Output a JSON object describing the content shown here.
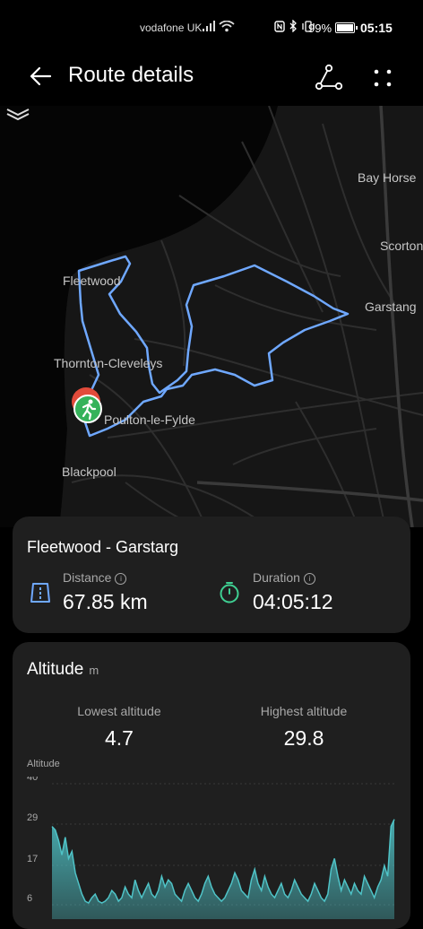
{
  "status": {
    "carrier": "vodafone UK",
    "battery": "99%",
    "time": "05:15"
  },
  "header": {
    "title": "Route details"
  },
  "map": {
    "labels": {
      "bay_horse": "Bay Horse",
      "scorton": "Scorton",
      "fleetwood": "Fleetwood",
      "garstang": "Garstang",
      "thornton": "Thornton-Cleveleys",
      "poulton": "Poulton-le-Fylde",
      "blackpool": "Blackpool"
    },
    "route_color": "#6fa8ff",
    "start_marker_color": "#35b25a"
  },
  "route": {
    "name": "Fleetwood - Garstarg",
    "distance_label": "Distance",
    "distance_value": "67.85 km",
    "duration_label": "Duration",
    "duration_value": "04:05:12"
  },
  "altitude": {
    "title": "Altitude",
    "unit": "m",
    "lowest_label": "Lowest altitude",
    "lowest_value": "4.7",
    "highest_label": "Highest altitude",
    "highest_value": "29.8"
  },
  "chart_data": {
    "type": "area",
    "title": "",
    "xlabel": "",
    "ylabel": "Altitude",
    "y_ticks": [
      "40",
      "29",
      "17",
      "6"
    ],
    "ylim": [
      6,
      40
    ],
    "color": "#4fc3c7",
    "values": [
      28,
      27,
      24,
      20,
      25,
      19,
      21,
      15,
      12,
      9,
      7,
      6.5,
      8,
      9,
      7,
      6.5,
      7,
      8,
      10,
      9,
      7,
      8,
      11,
      9,
      8,
      13,
      10,
      8,
      10,
      12,
      9,
      8,
      10,
      14,
      11,
      13,
      12,
      9,
      8,
      7,
      10,
      12,
      10,
      8,
      7,
      9,
      12,
      14,
      11,
      9,
      8,
      7,
      8,
      10,
      12,
      15,
      13,
      10,
      9,
      8,
      13,
      16,
      12,
      10,
      14,
      11,
      9,
      8,
      10,
      12,
      9,
      8,
      10,
      13,
      11,
      9,
      8,
      7,
      9,
      12,
      10,
      8,
      7,
      9,
      16,
      19,
      14,
      10,
      13,
      11,
      9,
      12,
      10,
      9,
      14,
      12,
      10,
      8,
      11,
      13,
      17,
      14,
      28,
      30
    ]
  }
}
